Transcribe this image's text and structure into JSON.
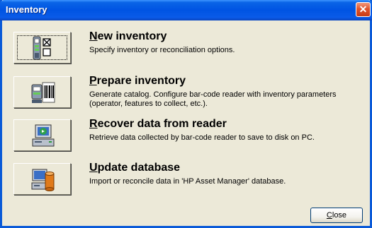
{
  "window": {
    "title": "Inventory"
  },
  "actions": [
    {
      "accel": "N",
      "title_rest": "ew inventory",
      "description": "Specify inventory or reconciliation options.",
      "icon": "barcode-reader-icon"
    },
    {
      "accel": "P",
      "title_rest": "repare inventory",
      "description": "Generate catalog. Configure bar-code reader with inventory parameters (operator, features to collect, etc.).",
      "icon": "barcode-scan-icon"
    },
    {
      "accel": "R",
      "title_rest": "ecover data from reader",
      "description": "Retrieve data collected by bar-code reader to save to disk on PC.",
      "icon": "recover-to-pc-icon"
    },
    {
      "accel": "U",
      "title_rest": "pdate database",
      "description": "Import or reconcile data in 'HP Asset Manager' database.",
      "icon": "database-update-icon"
    }
  ],
  "footer": {
    "close_accel": "C",
    "close_rest": "lose"
  },
  "colors": {
    "title_bar": "#0054e3",
    "dialog_bg": "#ece9d8",
    "close_x": "#e0542c"
  }
}
